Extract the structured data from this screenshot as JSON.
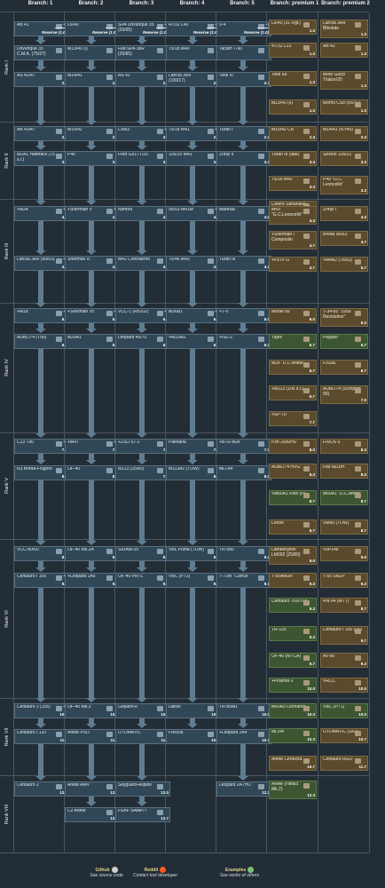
{
  "headers": [
    "Branch: 1",
    "Branch: 2",
    "Branch: 3",
    "Branch: 4",
    "Branch: 5",
    "Branch: premium 1",
    "Branch: premium 2"
  ],
  "ranks": [
    "Rank I",
    "Rank II",
    "Rank III",
    "Rank IV",
    "Rank V",
    "Rank VI",
    "Rank VII",
    "Rank VIII"
  ],
  "tech": [
    [
      "AB 41",
      "+2",
      "",
      "L6/40",
      "",
      "",
      "SPA Dovunque 35 (20/65)",
      "+2",
      "",
      "47/32 L40",
      "+2",
      "",
      "V-4",
      "+2",
      ""
    ],
    [
      "Dovunque 35 C.M.A. (75/27)",
      "",
      "",
      "M13/40 (I)",
      "",
      "",
      "Fiat-SPA 38R (20/65)",
      "",
      "",
      "75/18 M40",
      "",
      "",
      "Tacam T-60",
      "",
      ""
    ],
    [
      "AS 42/47",
      "",
      "2.7",
      "M14/41",
      "",
      "2.7",
      "AS 42",
      "",
      "2.7",
      "Lancia 3Ro (100/17)",
      "",
      "2.7",
      "Toldi III",
      "",
      "2.7"
    ],
    [
      "AB 43/47",
      "",
      "2.3",
      "M15/42",
      "",
      "2.3",
      "CM52",
      "+1",
      "3.3",
      "75/18 M41",
      "+2",
      "2.3",
      "Turan I",
      "",
      "2.3"
    ],
    [
      "M2A1 Halftrack (75 s.r.)",
      "",
      "3.3",
      "P40",
      "",
      "3.3",
      "Ford G917T/25",
      "",
      "3.3",
      "105/25 M43",
      "",
      "3.3",
      "Zrinyi II",
      "",
      "3.3"
    ],
    [
      "+M24",
      "+2",
      "4.0",
      "+Sherman V",
      "+2",
      "4.0",
      "Nimrod",
      "",
      "4.0",
      "90/53 M41M",
      "+2",
      "4.3",
      "Maresal",
      "",
      "4.0"
    ],
    [
      "Lancia 3Ro (90/53)",
      "+1",
      "4.7",
      "Sherman Ic",
      "",
      "4.7",
      "M42 Contraereo",
      "",
      "4.7",
      "75/46 M43",
      "",
      "4.7",
      "Turan III",
      "",
      "4.7"
    ],
    [
      "+M18",
      "+1",
      "6.0",
      "+Sherman Vc",
      "+1",
      "5.7",
      "VCC-1 (Rn202)",
      "+1",
      "6.0",
      "M36B1",
      "+1",
      "6.0",
      "+T-V",
      "",
      "6.0"
    ],
    [
      "AUBL/74 (T90)",
      "",
      "6.7",
      "M26A1",
      "",
      "6.7",
      "Leopard 40/70",
      "",
      "6.7",
      "+M109G",
      "",
      "6.7",
      "+ISZ-2",
      "",
      "6.7"
    ],
    [
      "C13 T90",
      "+1",
      "7.3",
      "+M47",
      "+2",
      "7.7",
      "+ZSU-57-2",
      "",
      "7.7",
      "Palmaria",
      "",
      "7.7",
      "+BTR-80A",
      "",
      "7.7"
    ],
    [
      "R3 Breda-Folgore",
      "",
      "8.0",
      "OF-40",
      "",
      "8.0",
      "M113 (25/80)",
      "",
      "7.3",
      "M113A1 (TOW)",
      "",
      "8.0",
      "MLI-84",
      "",
      "8.0"
    ],
    [
      "VCC-80/60",
      "",
      "8.3",
      "OF-40 Mk.2A",
      "",
      "9.0",
      "SIDAM-25",
      "",
      "9.0",
      "VBL Puma (TOW)",
      "",
      "9.0",
      "TR-580",
      "",
      "9.3"
    ],
    [
      "Centauro I 105",
      "+2",
      "9.7",
      "+Leopard 1A5",
      "",
      "9.7",
      "OF-40 PRTL",
      "",
      "9.3",
      "VBC (PT2)",
      "",
      "9.7",
      "T-72M \"Carrus\"",
      "",
      "9.7"
    ],
    [
      "Centauro 2 (105)",
      "+1",
      "10.0",
      "OF-40 Mk.3",
      "",
      "10.0",
      "Gepard-R",
      "",
      "10.0",
      "Dardo",
      "",
      "10.0",
      "TR-85M1",
      "",
      "10.0"
    ],
    [
      "Centauro I 120",
      "",
      "11.7",
      "Ariete PSO",
      "",
      "11.3",
      "OTOMATIC",
      "",
      "11.0",
      "Freccia",
      "",
      "10.7",
      "+Leopard 2A4",
      "",
      "10.7"
    ],
    [
      "Centauro 2",
      "",
      "12.0",
      "Ariete AMV",
      "",
      "12.3",
      "Skyguard-Aspide",
      "",
      "12.0",
      "",
      "",
      "",
      "Leopard 2A7HU",
      "",
      "12.3"
    ],
    [
      "",
      "",
      "",
      "C2 Ariete",
      "",
      "12.7",
      "FSAF SAMP/T",
      "",
      "12.7",
      "",
      "",
      "",
      "",
      "",
      ""
    ]
  ],
  "reserve_label": "Reserve (1.0)",
  "premium": [
    [
      "L6/40 (31 Rgt.)",
      "1.3",
      "Lancia 3Ro Blindato",
      "1.3"
    ],
    [
      "47/32 L13",
      "1.3",
      "AB 42",
      "1.3"
    ],
    [
      "Toldi IIa",
      "1.3",
      "Moto Guzzi Trialce/20",
      "1.3"
    ],
    [
      "M13/40 (II)",
      "1.3",
      "Morris CS8 (65/17)",
      "1.3"
    ],
    [
      "M15/42 CR",
      "2.3",
      "M14/41 (47/40)",
      "2.3"
    ],
    [
      "Turan III (late)",
      "3.3",
      "Sexton 105/22",
      "3.3"
    ],
    [
      "75/18 M42",
      "3.3",
      "P40 \"G.C. Leoncello\"",
      "3.3"
    ],
    [
      "Celere Sahariano",
      "3.3",
      "",
      ""
    ],
    [
      "M43 \"G.C.Leoncello\"",
      "4.3",
      "Zrinyi I",
      "4.3"
    ],
    [
      "+Sherman I Composito",
      "4.7",
      "Breda 90/53",
      "4.7"
    ],
    [
      "+Pz.IV G",
      "4.7",
      "+M4A2 (76/52)",
      "5.7"
    ],
    [
      "Model 89",
      "6.0",
      "T-34-85 \"1956 Revolution\"",
      "6.3"
    ],
    [
      "Tigris",
      "6.7",
      "Pegaso",
      "6.7"
    ],
    [
      "M26 \"D.C Ariete\"",
      "6.7",
      "F333E",
      "6.7"
    ],
    [
      "+M113 (106 s.r.)",
      "6.7",
      "AUBL/74 (Scorpion 90)",
      "7.0"
    ],
    [
      "+SP-70",
      "7.7",
      "",
      ""
    ],
    [
      "Pzh 2000HU",
      "8.0",
      "FIROS 6",
      "8.3"
    ],
    [
      "AUBL/74 HVG",
      "8.3",
      "Fiat 6616H",
      "8.3"
    ],
    [
      "+M60A1 Rise (P)",
      "8.7",
      "M60A1 \"D.C.Ariete\"",
      "8.7"
    ],
    [
      "Leone",
      "8.7",
      "VM90 (TOW)",
      "8.7"
    ],
    [
      "Lamborghini LM002 (25/80)",
      "9.0",
      "+9P148",
      "9.0"
    ],
    [
      "T-55AM2R",
      "9.3",
      "T-55 SRZP",
      "9.3"
    ],
    [
      "Centauro T60/70A",
      "9.3",
      "RN-94 (MTT)",
      "8.7"
    ],
    [
      "TR-125",
      "9.3",
      "Centauro I 105 (LS)",
      "9.7"
    ],
    [
      "OF-40 (MTCA)",
      "9.7",
      "AV-90",
      "9.3"
    ],
    [
      "+Piranha V",
      "10.0",
      "VRCC",
      "10.0"
    ],
    [
      "M60A3 Leonardo",
      "10.3",
      "VBC (PT1)",
      "10.0"
    ],
    [
      "MLVM",
      "10.3",
      "OTOMATIC (1A2)",
      "10.7"
    ],
    [
      "Ariete Certezza",
      "10.7",
      "Centauro RGO",
      "11.7"
    ],
    [
      "Ariete (Hitfact Mk.2)",
      "12.3",
      "",
      ""
    ]
  ],
  "footer": [
    {
      "title": "Github",
      "sub": "See source code",
      "icon": "github-icon",
      "color": "#cfcfcf"
    },
    {
      "title": "Reddit",
      "sub": "Contact tool developer",
      "icon": "reddit-icon",
      "color": "#ff5a1f"
    },
    {
      "title": "Examples",
      "sub": "See works of others",
      "icon": "examples-icon",
      "color": "#7ac37a"
    }
  ],
  "colors": {
    "background": "#232d36",
    "card": "#2f4756",
    "premium_card": "#5b4a2c",
    "premium_card_green": "#3d5531",
    "arrow": "#5f7d92",
    "footer_title": "#e6d28a"
  }
}
